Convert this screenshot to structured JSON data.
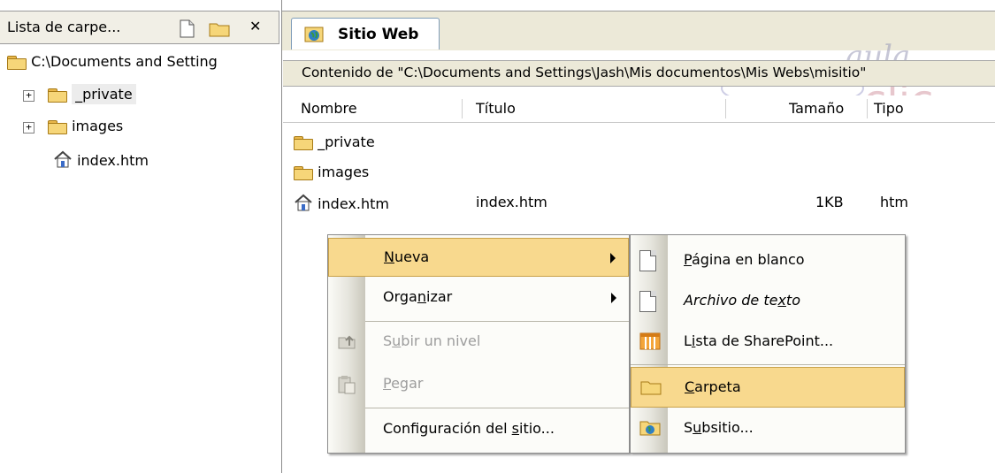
{
  "folder_pane": {
    "title": "Lista de carpe...",
    "close_glyph": "✕",
    "root": "C:\\Documents and Setting",
    "items": [
      {
        "label": "_private",
        "icon": "folder-icon",
        "expandable": true
      },
      {
        "label": "images",
        "icon": "folder-icon",
        "expandable": true
      },
      {
        "label": "index.htm",
        "icon": "home-page-icon",
        "expandable": false
      }
    ]
  },
  "tab": {
    "label": "Sitio Web",
    "icon": "website-icon"
  },
  "path_bar": {
    "text": "Contenido de \"C:\\Documents and Settings\\Jash\\Mis documentos\\Mis Webs\\misitio\""
  },
  "columns": {
    "name": "Nombre",
    "title": "Título",
    "size": "Tamaño",
    "type": "Tipo"
  },
  "files": [
    {
      "name": "_private",
      "title": "",
      "size": "",
      "type": "",
      "icon": "folder-icon"
    },
    {
      "name": "images",
      "title": "",
      "size": "",
      "type": "",
      "icon": "folder-icon"
    },
    {
      "name": "index.htm",
      "title": "index.htm",
      "size": "1KB",
      "type": "htm",
      "icon": "home-page-icon"
    }
  ],
  "context_menu": {
    "items": [
      {
        "pre": "",
        "key": "N",
        "post": "ueva",
        "submenu": true,
        "highlighted": true,
        "disabled": false
      },
      {
        "pre": "Orga",
        "key": "n",
        "post": "izar",
        "submenu": true,
        "highlighted": false,
        "disabled": false
      },
      {
        "pre": "S",
        "key": "u",
        "post": "bir un nivel",
        "submenu": false,
        "highlighted": false,
        "disabled": true,
        "icon": "up-folder-icon"
      },
      {
        "pre": "",
        "key": "P",
        "post": "egar",
        "submenu": false,
        "highlighted": false,
        "disabled": true,
        "icon": "paste-icon"
      },
      {
        "pre": "Configuración del ",
        "key": "s",
        "post": "itio...",
        "submenu": false,
        "highlighted": false,
        "disabled": false
      }
    ]
  },
  "submenu": {
    "items": [
      {
        "pre": "",
        "key": "P",
        "post": "ágina en blanco",
        "icon": "blank-page-icon",
        "highlighted": false
      },
      {
        "pre": "Archivo de te",
        "key": "x",
        "post": "to",
        "icon": "text-file-icon",
        "highlighted": false
      },
      {
        "pre": "L",
        "key": "i",
        "post": "sta de SharePoint...",
        "icon": "sharepoint-list-icon",
        "highlighted": false
      },
      {
        "pre": "",
        "key": "C",
        "post": "arpeta",
        "icon": "folder-icon",
        "highlighted": true
      },
      {
        "pre": "S",
        "key": "u",
        "post": "bsitio...",
        "icon": "subsite-icon",
        "highlighted": false
      }
    ]
  },
  "watermark": {
    "line1": "aula",
    "line2": "clic"
  },
  "colors": {
    "highlight": "#f8d98e",
    "folder": "#f6d679",
    "chrome": "#ece9d8",
    "watermark": "#c77a8a"
  }
}
